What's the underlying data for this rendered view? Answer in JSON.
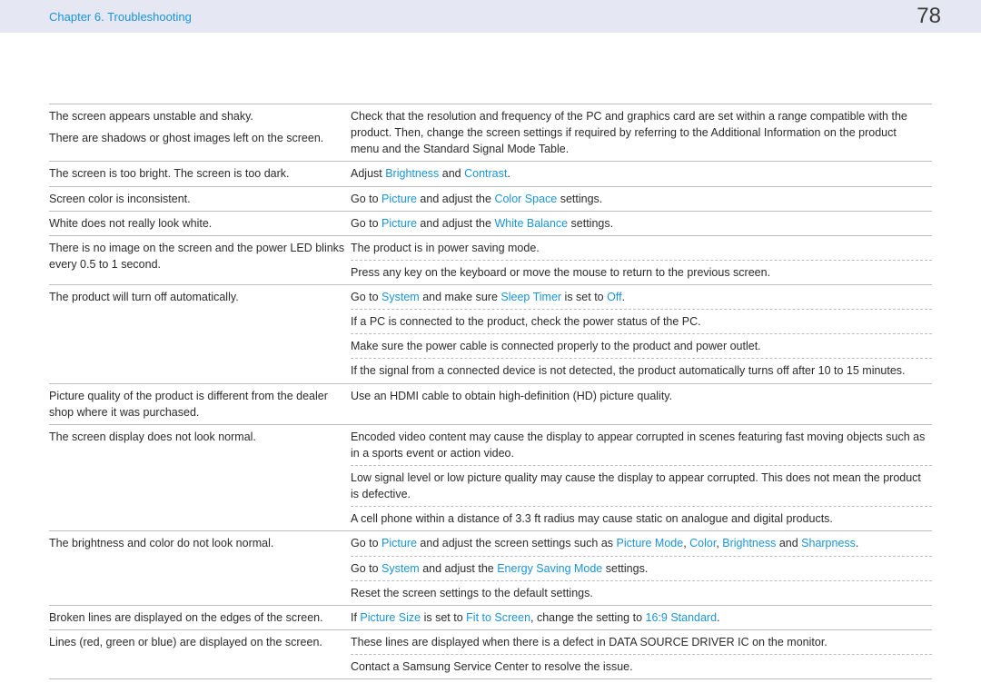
{
  "header": {
    "chapter": "Chapter 6. Troubleshooting",
    "page_number": "78"
  },
  "rows": [
    {
      "left": "The screen appears unstable and shaky.",
      "left2": "There are shadows or ghost images left on the screen.",
      "right": "Check that the resolution and frequency of the PC and graphics card are set within a range compatible with the product. Then, change the screen settings if required by referring to the Additional Information on the product menu and the Standard Signal Mode Table."
    },
    {
      "left": "The screen is too bright. The screen is too dark.",
      "right_pre": "Adjust ",
      "hl1": "Brightness",
      "mid1": " and ",
      "hl2": "Contrast",
      "post": "."
    },
    {
      "left": "Screen color is inconsistent.",
      "right_pre": "Go to ",
      "hl1": "Picture",
      "mid1": " and adjust the ",
      "hl2": "Color Space",
      "post": " settings."
    },
    {
      "left": "White does not really look white.",
      "right_pre": "Go to ",
      "hl1": "Picture",
      "mid1": " and adjust the ",
      "hl2": "White Balance",
      "post": " settings."
    },
    {
      "left": "There is no image on the screen and the power LED blinks every 0.5 to 1 second.",
      "right": "The product is in power saving mode."
    },
    {
      "right": "Press any key on the keyboard or move the mouse to return to the previous screen."
    },
    {
      "left": "The product will turn off automatically.",
      "right_pre": "Go to ",
      "hl1": "System",
      "mid1": " and make sure ",
      "hl2": "Sleep Timer",
      "mid2": " is set to ",
      "hl3": "Off",
      "post": "."
    },
    {
      "right": "If a PC is connected to the product, check the power status of the PC."
    },
    {
      "right": "Make sure the power cable is connected properly to the product and power outlet."
    },
    {
      "right": "If the signal from a connected device is not detected, the product automatically turns off after 10 to 15 minutes."
    },
    {
      "left": "Picture quality of the product is different from the dealer shop where it was purchased.",
      "right": "Use an HDMI cable to obtain high-definition (HD) picture quality."
    },
    {
      "left": "The screen display does not look normal.",
      "right": "Encoded video content may cause the display to appear corrupted in scenes featuring fast moving objects such as in a sports event or action video."
    },
    {
      "right": "Low signal level or low picture quality may cause the display to appear corrupted. This does not mean the product is defective."
    },
    {
      "right": "A cell phone within a distance of 3.3 ft radius may cause static on analogue and digital products."
    },
    {
      "left": "The brightness and color do not look normal.",
      "right_pre": "Go to ",
      "hl1": "Picture",
      "mid1": " and adjust the screen settings such as ",
      "hl2": "Picture Mode",
      "mid2": ", ",
      "hl3": "Color",
      "mid3": ", ",
      "hl4": "Brightness",
      "mid4": " and ",
      "hl5": "Sharpness",
      "post": "."
    },
    {
      "right_pre": "Go to ",
      "hl1": "System",
      "mid1": " and adjust the ",
      "hl2": "Energy Saving Mode",
      "post": " settings."
    },
    {
      "right": "Reset the screen settings to the default settings."
    },
    {
      "left": "Broken lines are displayed on the edges of the screen.",
      "right_pre": "If ",
      "hl1": "Picture Size",
      "mid1": " is set to ",
      "hl2": "Fit to Screen",
      "mid2": ", change the setting to ",
      "hl3": "16:9 Standard",
      "post": "."
    },
    {
      "left": "Lines (red, green or blue) are displayed on the screen.",
      "right": "These lines are displayed when there is a defect in DATA SOURCE DRIVER IC on the monitor."
    },
    {
      "right": "Contact a Samsung Service Center to resolve the issue."
    }
  ]
}
